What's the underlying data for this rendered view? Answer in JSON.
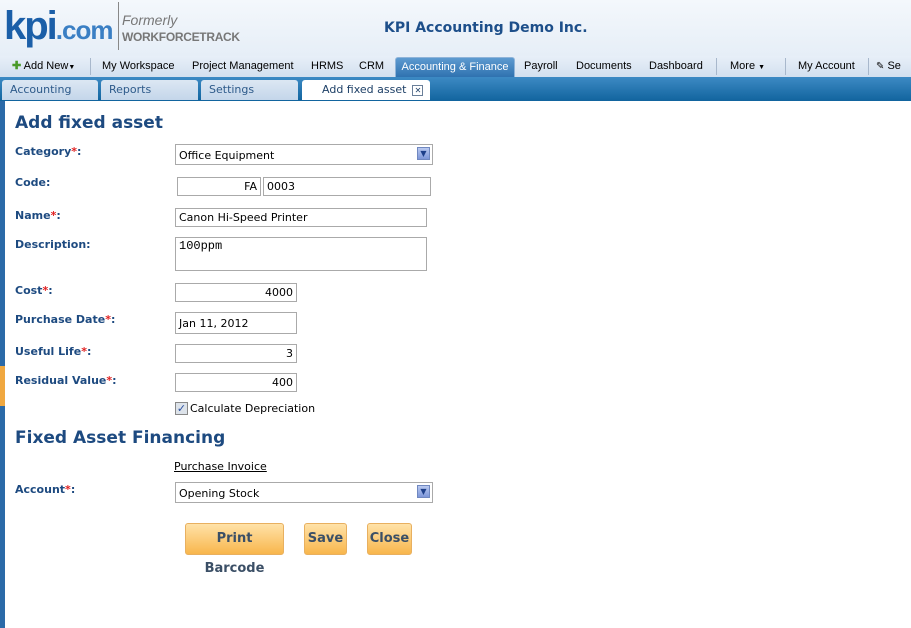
{
  "header": {
    "logo": "kpi.com",
    "formerly": "Formerly",
    "former_name": "WORKFORCETRACK",
    "company": "KPI Accounting Demo Inc."
  },
  "nav": {
    "add_new": "Add New",
    "items": [
      "My Workspace",
      "Project Management",
      "HRMS",
      "CRM",
      "Accounting & Finance",
      "Payroll",
      "Documents",
      "Dashboard"
    ],
    "more": "More",
    "my_account": "My Account",
    "settings": "Se"
  },
  "subtabs": [
    "Accounting",
    "Reports",
    "Settings",
    "Add fixed asset"
  ],
  "form": {
    "title": "Add fixed asset",
    "category_label": "Category",
    "category_value": "Office Equipment",
    "code_label": "Code:",
    "code_prefix": "FA",
    "code_value": "0003",
    "name_label": "Name",
    "name_value": "Canon Hi-Speed Printer",
    "description_label": "Description:",
    "description_value": "100ppm",
    "cost_label": "Cost",
    "cost_value": "4000",
    "purchase_date_label": "Purchase Date",
    "purchase_date_value": "Jan 11, 2012",
    "useful_life_label": "Useful Life",
    "useful_life_value": "3",
    "residual_label": "Residual Value",
    "residual_value": "400",
    "calc_dep_label": "Calculate Depreciation",
    "calc_dep_checked": true,
    "financing_title": "Fixed Asset Financing",
    "purchase_invoice_link": "Purchase Invoice",
    "account_label": "Account",
    "account_value": "Opening Stock",
    "required_mark": "*",
    "colon": ":"
  },
  "buttons": {
    "print_barcode": "Print Barcode",
    "save": "Save",
    "close": "Close"
  },
  "colors": {
    "heading": "#1d4a80",
    "required": "#e02020",
    "nav_active": "#2f72b0",
    "button": "#f8b64c"
  }
}
